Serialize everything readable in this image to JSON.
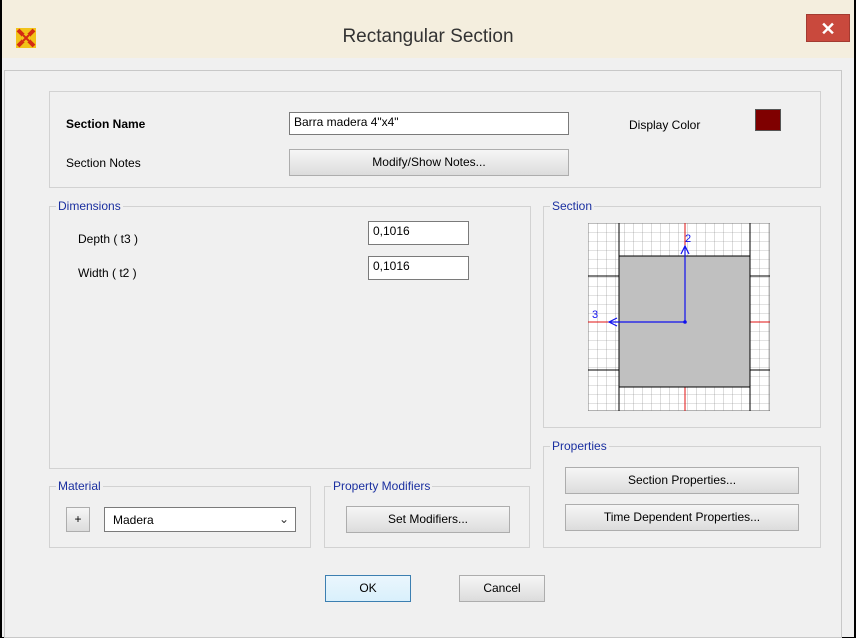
{
  "window": {
    "title": "Rectangular Section",
    "close_label": "✕"
  },
  "section_name": {
    "label": "Section Name",
    "value": "Barra madera 4\"x4\""
  },
  "section_notes": {
    "label": "Section Notes",
    "button": "Modify/Show Notes..."
  },
  "display_color": {
    "label": "Display Color",
    "color": "#7f0000"
  },
  "dimensions": {
    "legend": "Dimensions",
    "depth": {
      "label": "Depth  ( t3 )",
      "value": "0,1016"
    },
    "width": {
      "label": "Width  ( t2 )",
      "value": "0,1016"
    }
  },
  "section_preview": {
    "legend": "Section",
    "axis_vertical": "2",
    "axis_horizontal": "3",
    "fill_color": "#c0c0c0",
    "axis_color": "#1010ee",
    "center_line_color": "#e01010"
  },
  "material": {
    "legend": "Material",
    "add_label": "+",
    "selected": "Madera"
  },
  "property_modifiers": {
    "legend": "Property Modifiers",
    "button": "Set Modifiers..."
  },
  "properties": {
    "legend": "Properties",
    "section_button": "Section Properties...",
    "time_button": "Time Dependent Properties..."
  },
  "footer": {
    "ok": "OK",
    "cancel": "Cancel"
  }
}
